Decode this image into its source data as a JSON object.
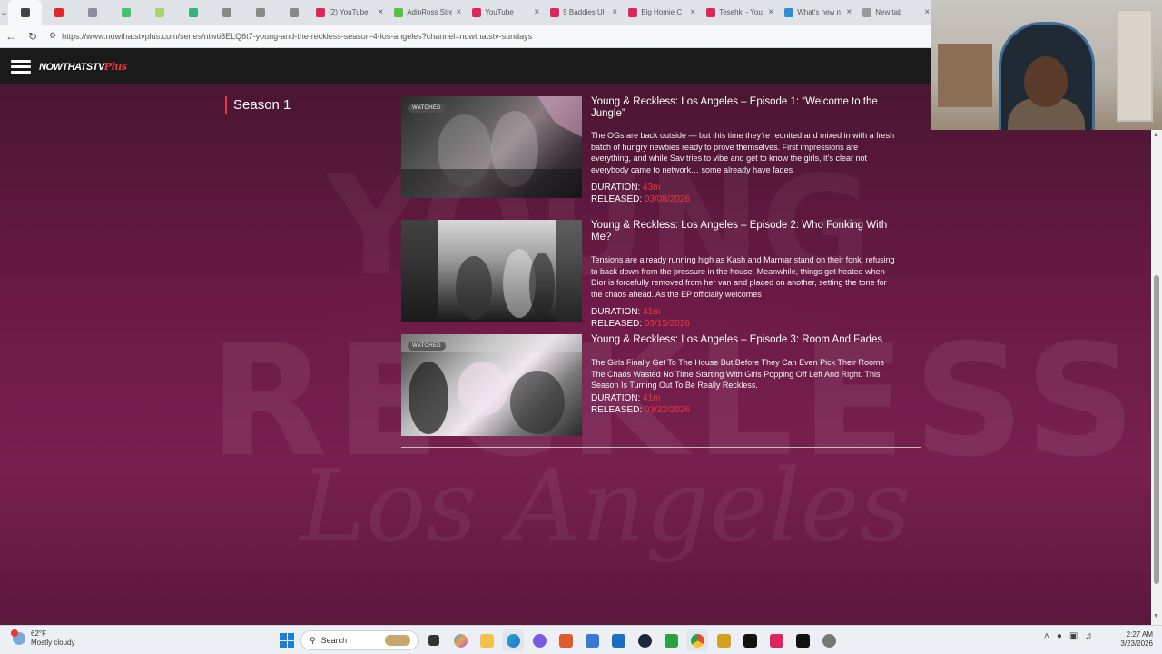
{
  "browser": {
    "tabs": [
      {
        "label": "",
        "icon": "browser-icon",
        "color": "#444444",
        "active": true
      },
      {
        "label": "",
        "icon": "red-app-icon",
        "color": "#e02828"
      },
      {
        "label": "",
        "icon": "tab-icon",
        "color": "#8a8aa0"
      },
      {
        "label": "",
        "icon": "tab-icon",
        "color": "#3fc46a"
      },
      {
        "label": "",
        "icon": "tab-icon",
        "color": "#b0d070"
      },
      {
        "label": "",
        "icon": "tab-icon",
        "color": "#38b080"
      },
      {
        "label": "",
        "icon": "globe-icon",
        "color": "#888888"
      },
      {
        "label": "",
        "icon": "globe-icon",
        "color": "#888888"
      },
      {
        "label": "",
        "icon": "globe-icon",
        "color": "#888888"
      },
      {
        "label": "(2) YouTube",
        "icon": "youtube-icon",
        "color": "#e0245e"
      },
      {
        "label": "AdinRoss Stre",
        "icon": "kick-icon",
        "color": "#53c046"
      },
      {
        "label": "YouTube",
        "icon": "youtube-icon",
        "color": "#e0245e"
      },
      {
        "label": "5 Baddies Ul",
        "icon": "site-icon",
        "color": "#e0245e"
      },
      {
        "label": "Big Homie C",
        "icon": "youtube-icon",
        "color": "#e0245e"
      },
      {
        "label": "Tesehki - You",
        "icon": "youtube-icon",
        "color": "#e0245e"
      },
      {
        "label": "What's new n",
        "icon": "edge-icon",
        "color": "#2a8fd6"
      },
      {
        "label": "New tab",
        "icon": "newtab-icon",
        "color": "#999999"
      }
    ],
    "url": "https://www.nowthatstvplus.com/series/ntwti8ELQ6t7-young-and-the-reckless-season-4-los-angeles?channel=nowthatstv-sundays"
  },
  "site": {
    "logo_main": "NOWTHATSTV",
    "logo_plus": "Plus"
  },
  "season": {
    "label": "Season 1"
  },
  "episodes": [
    {
      "title": "Young & Reckless: Los Angeles – Episode 1: “Welcome to the Jungle”",
      "description": "The OGs are back outside — but this time they’re reunited and mixed in with a fresh batch of hungry newbies ready to prove themselves. First impressions are everything, and while Sav tries to vibe and get to know the girls, it’s clear not everybody came to network… some already have fades",
      "duration_label": "DURATION:",
      "duration": "43m",
      "released_label": "RELEASED:",
      "released": "03/08/2026",
      "badge": "WATCHED"
    },
    {
      "title": "Young & Reckless: Los Angeles – Episode 2: Who Fonking With Me?",
      "description": "Tensions are already running high as Kash and Marmar stand on their fonk, refusing to back down from the pressure in the house. Meanwhile, things get heated when Dior is forcefully removed from her van and placed on another, setting the tone for the chaos ahead. As the EP officially welcomes",
      "duration_label": "DURATION:",
      "duration": "41m",
      "released_label": "RELEASED:",
      "released": "03/15/2026",
      "badge": ""
    },
    {
      "title": "Young & Reckless: Los Angeles – Episode 3: Room And Fades",
      "description": "The Girls Finally Get To The House But Before They Can Even Pick Their Rooms The Chaos Wasted No Time Starting With Girls Popping Off Left And Right. This Season Is Turning Out To Be Really Reckless.",
      "duration_label": "DURATION:",
      "duration": "41m",
      "released_label": "RELEASED:",
      "released": "03/22/2026",
      "badge": "WATCHED"
    }
  ],
  "background_text": {
    "word1": "RECKLESS",
    "word2": "Los Angeles",
    "word3": "YOUNG"
  },
  "taskbar": {
    "weather_temp": "62°F",
    "weather_desc": "Mostly cloudy",
    "search_label": "Search",
    "time": "2:27 AM",
    "date": "3/23/2026"
  },
  "colors": {
    "accent": "#e8383d",
    "page_bg": "#6a1a45"
  }
}
